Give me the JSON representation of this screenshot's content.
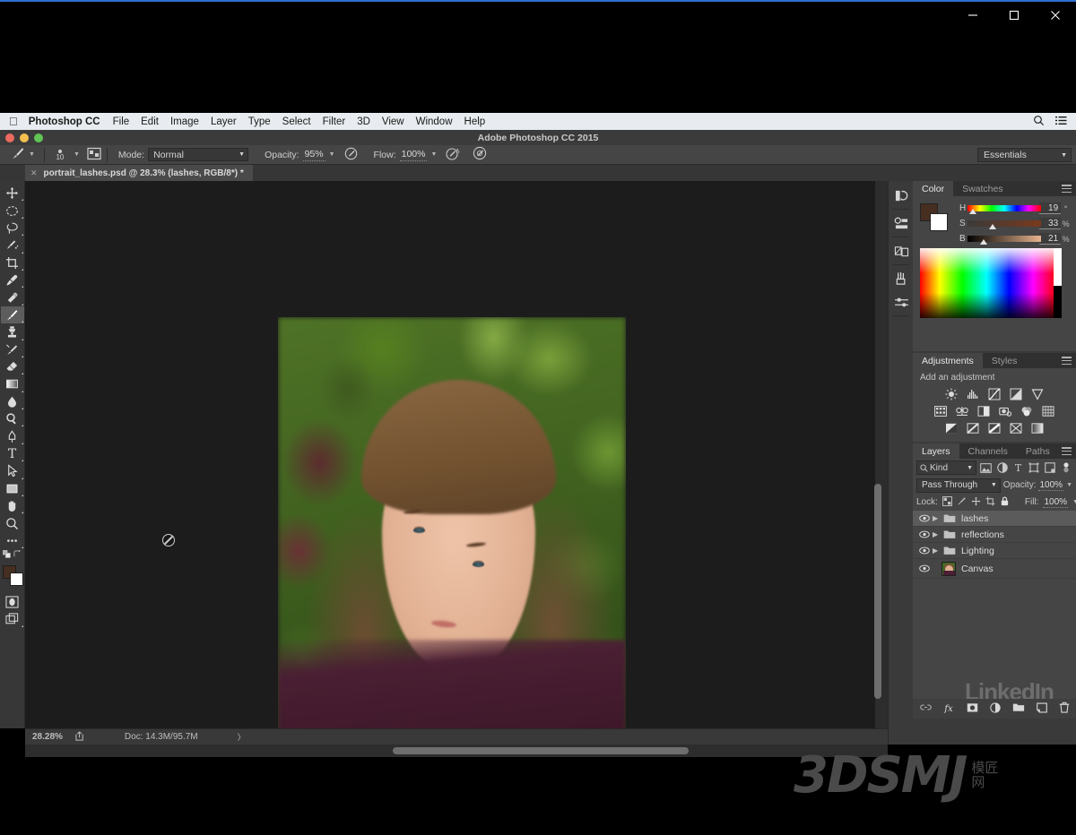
{
  "os_window": {
    "minimize_label": "—",
    "maximize_label": "□",
    "close_label": "✕"
  },
  "mac_menubar": {
    "apple_glyph": "",
    "app_name": "Photoshop CC",
    "items": [
      "File",
      "Edit",
      "Image",
      "Layer",
      "Type",
      "Select",
      "Filter",
      "3D",
      "View",
      "Window",
      "Help"
    ],
    "right_icons": [
      "search-icon",
      "list-icon"
    ]
  },
  "ps_window": {
    "title": "Adobe Photoshop CC 2015"
  },
  "options_bar": {
    "tool_icon": "brush-icon",
    "brush_size": "10",
    "brush_preset_icon": "brush-preset-picker-icon",
    "mode_label": "Mode:",
    "mode_value": "Normal",
    "opacity_label": "Opacity:",
    "opacity_value": "95%",
    "opacity_pressure_icon": "pressure-opacity-icon",
    "flow_label": "Flow:",
    "flow_value": "100%",
    "airbrush_icon": "airbrush-icon",
    "smoothing_icon": "smoothing-icon",
    "workspace": "Essentials"
  },
  "document_tab": {
    "close_glyph": "✕",
    "title": "portrait_lashes.psd @ 28.3% (lashes, RGB/8*) *"
  },
  "toolbar": {
    "tools": [
      {
        "name": "move-tool",
        "selected": false
      },
      {
        "name": "elliptical-marquee-tool",
        "selected": false
      },
      {
        "name": "lasso-tool",
        "selected": false
      },
      {
        "name": "quick-selection-tool",
        "selected": false
      },
      {
        "name": "crop-tool",
        "selected": false
      },
      {
        "name": "eyedropper-tool",
        "selected": false
      },
      {
        "name": "spot-healing-brush-tool",
        "selected": false
      },
      {
        "name": "brush-tool",
        "selected": true
      },
      {
        "name": "clone-stamp-tool",
        "selected": false
      },
      {
        "name": "history-brush-tool",
        "selected": false
      },
      {
        "name": "eraser-tool",
        "selected": false
      },
      {
        "name": "gradient-tool",
        "selected": false
      },
      {
        "name": "blur-tool",
        "selected": false
      },
      {
        "name": "dodge-tool",
        "selected": false
      },
      {
        "name": "pen-tool",
        "selected": false
      },
      {
        "name": "type-tool",
        "selected": false
      },
      {
        "name": "path-selection-tool",
        "selected": false
      },
      {
        "name": "rectangle-tool",
        "selected": false
      },
      {
        "name": "hand-tool",
        "selected": false
      },
      {
        "name": "zoom-tool",
        "selected": false
      },
      {
        "name": "edit-toolbar-tool",
        "selected": false
      }
    ],
    "foreground_color": "#462e21",
    "background_color": "#ffffff",
    "quick-mask-icon": "quick-mask-icon",
    "screen-mode-icon": "screen-mode-icon"
  },
  "canvas": {
    "cursor": "no-entry-cursor",
    "image_subject": "portrait of young woman with brown hair on green foliage background"
  },
  "status_bar": {
    "zoom": "28.28%",
    "share_icon": "share-icon",
    "doc_info": "Doc: 14.3M/95.7M",
    "expand_glyph": "〉"
  },
  "dock_strip": {
    "buttons": [
      "history-panel-icon",
      "properties-panel-icon",
      "layer-comps-panel-icon",
      "brush-panel-icon",
      "brush-settings-panel-icon"
    ]
  },
  "color_panel": {
    "tabs": [
      {
        "label": "Color",
        "active": true
      },
      {
        "label": "Swatches",
        "active": false
      }
    ],
    "menu_icon": "panel-menu-icon",
    "foreground_color": "#462e21",
    "background_color": "#ffffff",
    "sliders": [
      {
        "label": "H",
        "value": "19",
        "unit": "°",
        "thumb_pct": 7
      },
      {
        "label": "S",
        "value": "33",
        "unit": "%",
        "thumb_pct": 33
      },
      {
        "label": "B",
        "value": "21",
        "unit": "%",
        "thumb_pct": 21
      }
    ]
  },
  "adjustments_panel": {
    "tabs": [
      {
        "label": "Adjustments",
        "active": true
      },
      {
        "label": "Styles",
        "active": false
      }
    ],
    "menu_icon": "panel-menu-icon",
    "title": "Add an adjustment",
    "row1": [
      "brightness-contrast-icon",
      "levels-icon",
      "curves-icon",
      "exposure-icon",
      "vibrance-icon"
    ],
    "row2": [
      "hue-saturation-icon",
      "color-balance-icon",
      "black-white-icon",
      "photo-filter-icon",
      "channel-mixer-icon",
      "color-lookup-icon"
    ],
    "row3": [
      "invert-icon",
      "posterize-icon",
      "threshold-icon",
      "selective-color-icon",
      "gradient-map-icon"
    ]
  },
  "layers_panel": {
    "tabs": [
      {
        "label": "Layers",
        "active": true
      },
      {
        "label": "Channels",
        "active": false
      },
      {
        "label": "Paths",
        "active": false
      }
    ],
    "menu_icon": "panel-menu-icon",
    "filter_kind": "Kind",
    "filter_icons": [
      "filter-pixel-icon",
      "filter-adjustment-icon",
      "filter-type-icon",
      "filter-shape-icon",
      "filter-smart-object-icon",
      "filter-toggle-icon"
    ],
    "blend_mode": "Pass Through",
    "opacity_label": "Opacity:",
    "opacity_value": "100%",
    "lock_label": "Lock:",
    "lock_icons": [
      "lock-transparent-pixels-icon",
      "lock-image-pixels-icon",
      "lock-position-icon",
      "lock-artboard-nesting-icon",
      "lock-all-icon"
    ],
    "fill_label": "Fill:",
    "fill_value": "100%",
    "layers": [
      {
        "name": "lashes",
        "type": "group",
        "visible": true,
        "selected": true
      },
      {
        "name": "reflections",
        "type": "group",
        "visible": true,
        "selected": false
      },
      {
        "name": "Lighting",
        "type": "group",
        "visible": true,
        "selected": false
      },
      {
        "name": "Canvas",
        "type": "image",
        "visible": true,
        "selected": false
      }
    ],
    "footer_icons": [
      "link-layers-icon",
      "layer-style-fx-icon",
      "add-layer-mask-icon",
      "new-adjustment-layer-icon",
      "new-group-icon",
      "new-layer-icon",
      "delete-layer-icon"
    ],
    "watermark": "LinkedIn"
  },
  "watermark": {
    "brand": "3DSMJ",
    "cn_line1": "模匠",
    "cn_line2": "网"
  }
}
